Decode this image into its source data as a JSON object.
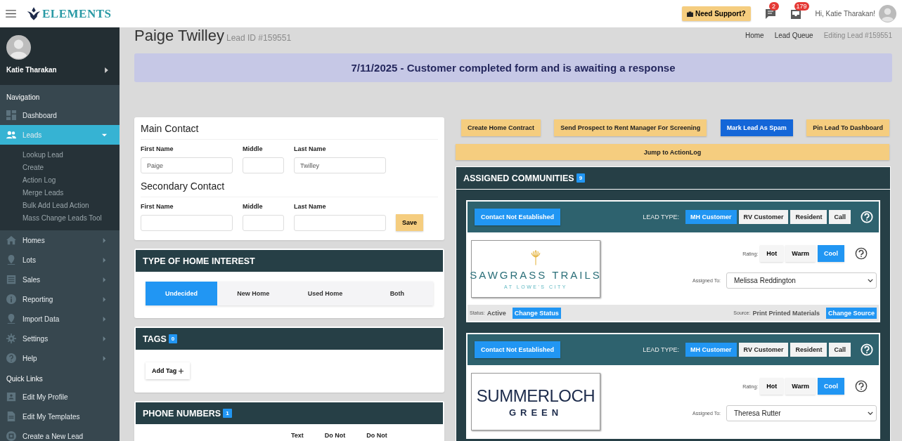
{
  "header": {
    "logo_text": "ELEMENTS",
    "support_button": "Need Support?",
    "message_count": "2",
    "notification_count": "179",
    "greeting": "Hi, Katie Tharakan!"
  },
  "sidebar": {
    "user_name": "Katie Tharakan",
    "nav_heading": "Navigation",
    "nav_items": [
      {
        "label": "Dashboard",
        "selected": false
      },
      {
        "label": "Leads",
        "selected": true,
        "expanded": true,
        "children": [
          {
            "label": "Lookup Lead"
          },
          {
            "label": "Create"
          },
          {
            "label": "Action Log"
          },
          {
            "label": "Merge Leads"
          },
          {
            "label": "Bulk Add Lead Action"
          },
          {
            "label": "Mass Change Leads Tool"
          }
        ]
      },
      {
        "label": "Homes",
        "selected": false,
        "expanded": false
      },
      {
        "label": "Lots",
        "selected": false,
        "expanded": false
      },
      {
        "label": "Sales",
        "selected": false,
        "expanded": false
      },
      {
        "label": "Reporting",
        "selected": false,
        "expanded": false
      },
      {
        "label": "Import Data",
        "selected": false,
        "expanded": false
      },
      {
        "label": "Settings",
        "selected": false,
        "expanded": false
      },
      {
        "label": "Help",
        "selected": false,
        "expanded": false
      }
    ],
    "quick_heading": "Quick Links",
    "quick_links": [
      {
        "label": "Edit My Profile"
      },
      {
        "label": "Edit My Templates"
      },
      {
        "label": "Create a New Lead"
      }
    ]
  },
  "page": {
    "title": "Paige Twilley",
    "lead_id": "Lead ID #159551",
    "breadcrumbs": [
      {
        "label": "Home",
        "current": false
      },
      {
        "label": "Lead Queue",
        "current": false
      },
      {
        "label": "Editing Lead #159551",
        "current": true
      }
    ],
    "banner": "7/11/2025 - Customer completed form and is awaiting a response"
  },
  "contact": {
    "main_heading": "Main Contact",
    "main_fields": [
      {
        "label": "First Name",
        "value": "Paige"
      },
      {
        "label": "Middle"
      },
      {
        "label": "Last Name",
        "value": "Twilley"
      }
    ],
    "secondary_heading": "Secondary Contact",
    "secondary_fields": [
      {
        "label": "First Name"
      },
      {
        "label": "Middle"
      },
      {
        "label": "Last Name"
      }
    ],
    "save_button": "Save"
  },
  "home_interest": {
    "title": "TYPE OF HOME INTEREST",
    "options": [
      {
        "label": "Undecided",
        "selected": true
      },
      {
        "label": "New Home",
        "selected": false
      },
      {
        "label": "Used Home",
        "selected": false
      },
      {
        "label": "Both",
        "selected": false
      }
    ]
  },
  "tags": {
    "title": "TAGS",
    "count": "0",
    "add_button": "Add Tag"
  },
  "phone_numbers": {
    "title": "PHONE NUMBERS",
    "count": "1",
    "columns": [
      "Text",
      "Do Not",
      "Do Not"
    ]
  },
  "actions": [
    {
      "label": "Create Home Contract",
      "kind": "warning"
    },
    {
      "label": "Send Prospect to Rent Manager For Screening",
      "kind": "warning"
    },
    {
      "label": "Mark Lead As Spam",
      "kind": "primary"
    },
    {
      "label": "Pin Lead To Dashboard",
      "kind": "warning"
    }
  ],
  "jump_button": "Jump to ActionLog",
  "communities": {
    "title": "ASSIGNED COMMUNITIES",
    "count": "9",
    "cards": [
      {
        "contact_status": "Contact Not Established",
        "lead_type_label": "LEAD TYPE:",
        "lead_types": [
          {
            "label": "MH Customer",
            "selected": true
          },
          {
            "label": "RV Customer",
            "selected": false
          },
          {
            "label": "Resident",
            "selected": false
          },
          {
            "label": "Call",
            "selected": false
          }
        ],
        "logo": {
          "kind": "palm",
          "name": "SAWGRASS TRAILS",
          "tagline": "AT LOWE'S CITY"
        },
        "rating_label": "Rating:",
        "ratings": [
          {
            "label": "Hot",
            "selected": false
          },
          {
            "label": "Warm",
            "selected": false
          },
          {
            "label": "Cool",
            "selected": true
          }
        ],
        "assigned_label": "Assigned To:",
        "assigned_to": "Melissa Reddington",
        "footer": {
          "status_label": "Status:",
          "status": "Active",
          "change_status": "Change Status",
          "source_label": "Source:",
          "source": "Print Printed Materials",
          "change_source": "Change Source"
        }
      },
      {
        "contact_status": "Contact Not Established",
        "lead_type_label": "LEAD TYPE:",
        "lead_types": [
          {
            "label": "MH Customer",
            "selected": true
          },
          {
            "label": "RV Customer",
            "selected": false
          },
          {
            "label": "Resident",
            "selected": false
          },
          {
            "label": "Call",
            "selected": false
          }
        ],
        "logo": {
          "kind": "plain",
          "name": "SUMMERLOCH",
          "tagline": "GREEN"
        },
        "rating_label": "Rating:",
        "ratings": [
          {
            "label": "Hot",
            "selected": false
          },
          {
            "label": "Warm",
            "selected": false
          },
          {
            "label": "Cool",
            "selected": true
          }
        ],
        "assigned_label": "Assigned To:",
        "assigned_to": "Theresa Rutter"
      }
    ]
  }
}
